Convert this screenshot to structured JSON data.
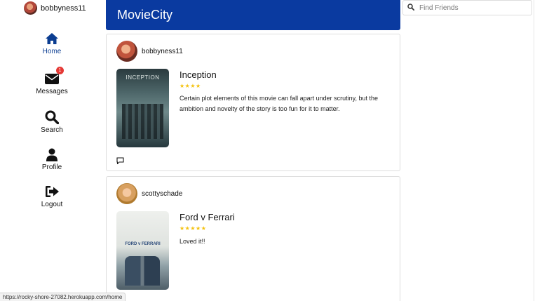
{
  "user": {
    "username": "bobbyness11"
  },
  "nav": [
    {
      "label": "Home",
      "icon": "home-icon",
      "active": true
    },
    {
      "label": "Messages",
      "icon": "envelope-icon",
      "badge": "1"
    },
    {
      "label": "Search",
      "icon": "search-icon"
    },
    {
      "label": "Profile",
      "icon": "user-icon"
    },
    {
      "label": "Logout",
      "icon": "sign-out-icon"
    }
  ],
  "header": {
    "title": "MovieCity"
  },
  "search": {
    "placeholder": "Find Friends",
    "value": ""
  },
  "posts": [
    {
      "username": "bobbyness11",
      "poster_text": "INCEPTION",
      "movie_title": "Inception",
      "rating": 4,
      "stars": "★★★★",
      "review": "Certain plot elements of this movie can fall apart under scrutiny, but the ambition and novelty of the story is too fun for it to matter."
    },
    {
      "username": "scottyschade",
      "poster_text": "FORD v FERRARI",
      "movie_title": "Ford v Ferrari",
      "rating": 5,
      "stars": "★★★★★",
      "review": "Loved it!!"
    }
  ],
  "statusbar": {
    "url": "https://rocky-shore-27082.herokuapp.com/home"
  },
  "colors": {
    "header": "#0a3aa0",
    "active_nav": "#0b3d91",
    "star": "#f4c20d",
    "badge": "#e53935"
  }
}
